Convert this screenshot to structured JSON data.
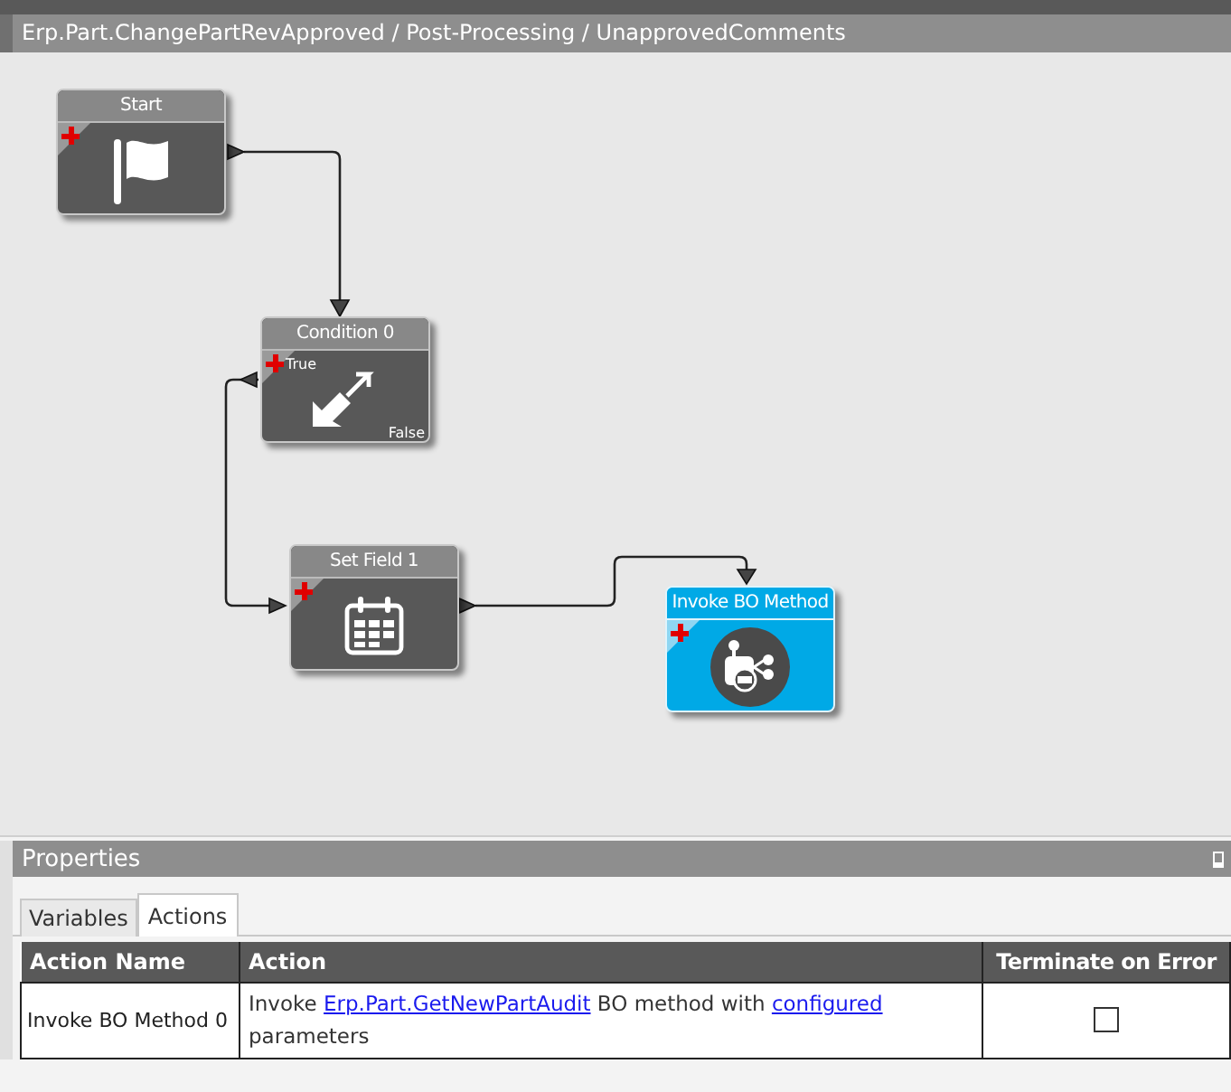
{
  "editor": {
    "title": "Erp.Part.ChangePartRevApproved / Post-Processing / UnapprovedComments"
  },
  "diagram": {
    "nodes": [
      {
        "kind": "start",
        "title": "Start",
        "selected": false
      },
      {
        "kind": "condition",
        "title": "Condition 0",
        "true_label": "True",
        "false_label": "False",
        "selected": false
      },
      {
        "kind": "set_field",
        "title": "Set Field 1",
        "selected": false
      },
      {
        "kind": "invoke_bo",
        "title": "Invoke BO Method",
        "selected": true
      }
    ]
  },
  "properties": {
    "title": "Properties",
    "tabs": [
      {
        "label": "Variables",
        "selected": false
      },
      {
        "label": "Actions",
        "selected": true
      }
    ],
    "table": {
      "columns": [
        "Action Name",
        "Action",
        "Terminate on Error"
      ],
      "rows": [
        {
          "action_name": "Invoke BO Method 0",
          "action": [
            {
              "text": "Invoke "
            },
            {
              "text": "Erp.Part.GetNewPartAudit",
              "link": true
            },
            {
              "text": " BO method with "
            },
            {
              "text": "configured",
              "link": true
            },
            {
              "text": " parameters"
            }
          ],
          "terminate_on_error": false
        }
      ]
    }
  }
}
